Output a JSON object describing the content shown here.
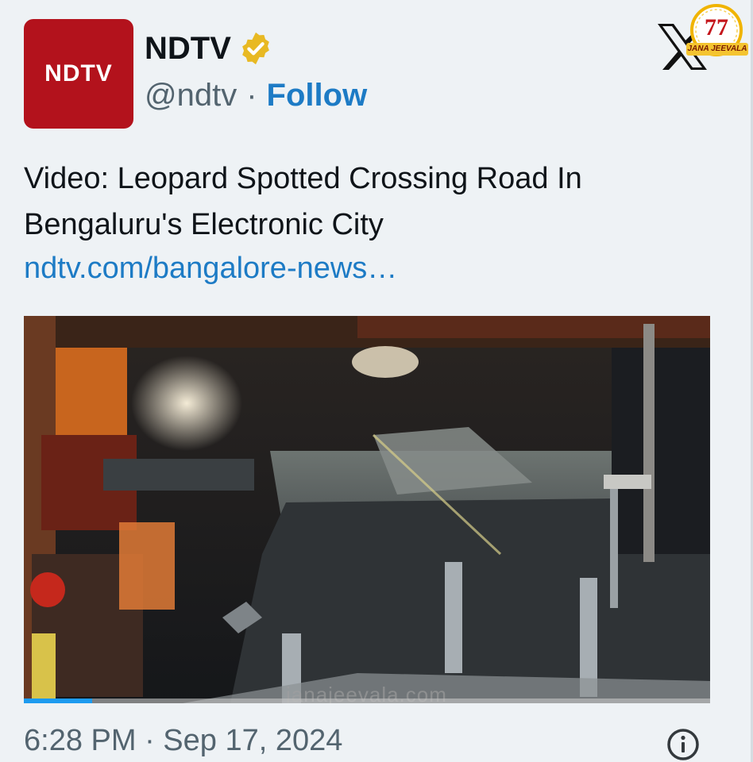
{
  "account": {
    "avatar_text": "NDTV",
    "display_name": "NDTV",
    "handle": "@ndtv",
    "separator": "·",
    "follow_label": "Follow"
  },
  "icons": {
    "verified": "verified-badge-icon",
    "x": "x-logo-icon",
    "info": "info-icon"
  },
  "channel_badge": {
    "number": "77",
    "ribbon": "JANA JEEVALA"
  },
  "tweet": {
    "text": "Video: Leopard Spotted Crossing Road In Bengaluru's Electronic City",
    "link": "ndtv.com/bangalore-news…"
  },
  "media": {
    "watermark": "janajeevala.com",
    "progress": 0.1
  },
  "footer": {
    "timestamp": "6:28 PM · Sep 17, 2024"
  },
  "colors": {
    "brand_red": "#b3121c",
    "link_blue": "#1d7bc5",
    "verified_gold": "#e8b923",
    "progress_blue": "#1d9bf0"
  }
}
